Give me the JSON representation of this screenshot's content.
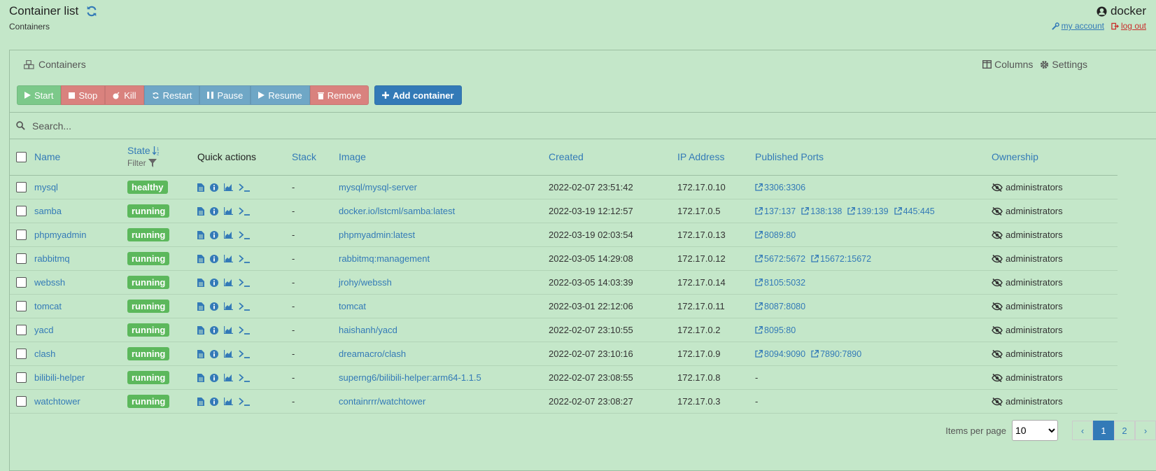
{
  "header": {
    "title": "Container list",
    "subtitle": "Containers",
    "user": "docker",
    "my_account": "my account",
    "log_out": "log out"
  },
  "panel": {
    "title": "Containers",
    "columns_label": "Columns",
    "settings_label": "Settings"
  },
  "toolbar": {
    "start": "Start",
    "stop": "Stop",
    "kill": "Kill",
    "restart": "Restart",
    "pause": "Pause",
    "resume": "Resume",
    "remove": "Remove",
    "add": "Add container"
  },
  "search": {
    "placeholder": "Search..."
  },
  "table": {
    "headers": {
      "name": "Name",
      "state": "State",
      "filter": "Filter",
      "quick_actions": "Quick actions",
      "stack": "Stack",
      "image": "Image",
      "created": "Created",
      "ip": "IP Address",
      "ports": "Published Ports",
      "ownership": "Ownership"
    },
    "rows": [
      {
        "name": "mysql",
        "state": "healthy",
        "stack": "-",
        "image": "mysql/mysql-server",
        "created": "2022-02-07 23:51:42",
        "ip": "172.17.0.10",
        "ports": [
          "3306:3306"
        ],
        "ownership": "administrators"
      },
      {
        "name": "samba",
        "state": "running",
        "stack": "-",
        "image": "docker.io/lstcml/samba:latest",
        "created": "2022-03-19 12:12:57",
        "ip": "172.17.0.5",
        "ports": [
          "137:137",
          "138:138",
          "139:139",
          "445:445"
        ],
        "ownership": "administrators"
      },
      {
        "name": "phpmyadmin",
        "state": "running",
        "stack": "-",
        "image": "phpmyadmin:latest",
        "created": "2022-03-19 02:03:54",
        "ip": "172.17.0.13",
        "ports": [
          "8089:80"
        ],
        "ownership": "administrators"
      },
      {
        "name": "rabbitmq",
        "state": "running",
        "stack": "-",
        "image": "rabbitmq:management",
        "created": "2022-03-05 14:29:08",
        "ip": "172.17.0.12",
        "ports": [
          "5672:5672",
          "15672:15672"
        ],
        "ownership": "administrators"
      },
      {
        "name": "webssh",
        "state": "running",
        "stack": "-",
        "image": "jrohy/webssh",
        "created": "2022-03-05 14:03:39",
        "ip": "172.17.0.14",
        "ports": [
          "8105:5032"
        ],
        "ownership": "administrators"
      },
      {
        "name": "tomcat",
        "state": "running",
        "stack": "-",
        "image": "tomcat",
        "created": "2022-03-01 22:12:06",
        "ip": "172.17.0.11",
        "ports": [
          "8087:8080"
        ],
        "ownership": "administrators"
      },
      {
        "name": "yacd",
        "state": "running",
        "stack": "-",
        "image": "haishanh/yacd",
        "created": "2022-02-07 23:10:55",
        "ip": "172.17.0.2",
        "ports": [
          "8095:80"
        ],
        "ownership": "administrators"
      },
      {
        "name": "clash",
        "state": "running",
        "stack": "-",
        "image": "dreamacro/clash",
        "created": "2022-02-07 23:10:16",
        "ip": "172.17.0.9",
        "ports": [
          "8094:9090",
          "7890:7890"
        ],
        "ownership": "administrators"
      },
      {
        "name": "bilibili-helper",
        "state": "running",
        "stack": "-",
        "image": "superng6/bilibili-helper:arm64-1.1.5",
        "created": "2022-02-07 23:08:55",
        "ip": "172.17.0.8",
        "ports": [],
        "ownership": "administrators"
      },
      {
        "name": "watchtower",
        "state": "running",
        "stack": "-",
        "image": "containrrr/watchtower",
        "created": "2022-02-07 23:08:27",
        "ip": "172.17.0.3",
        "ports": [],
        "ownership": "administrators"
      }
    ],
    "no_ports": "-"
  },
  "pagination": {
    "items_per_page_label": "Items per page",
    "items_per_page": "10",
    "prev": "‹",
    "pages": [
      "1",
      "2"
    ],
    "next": "›"
  }
}
